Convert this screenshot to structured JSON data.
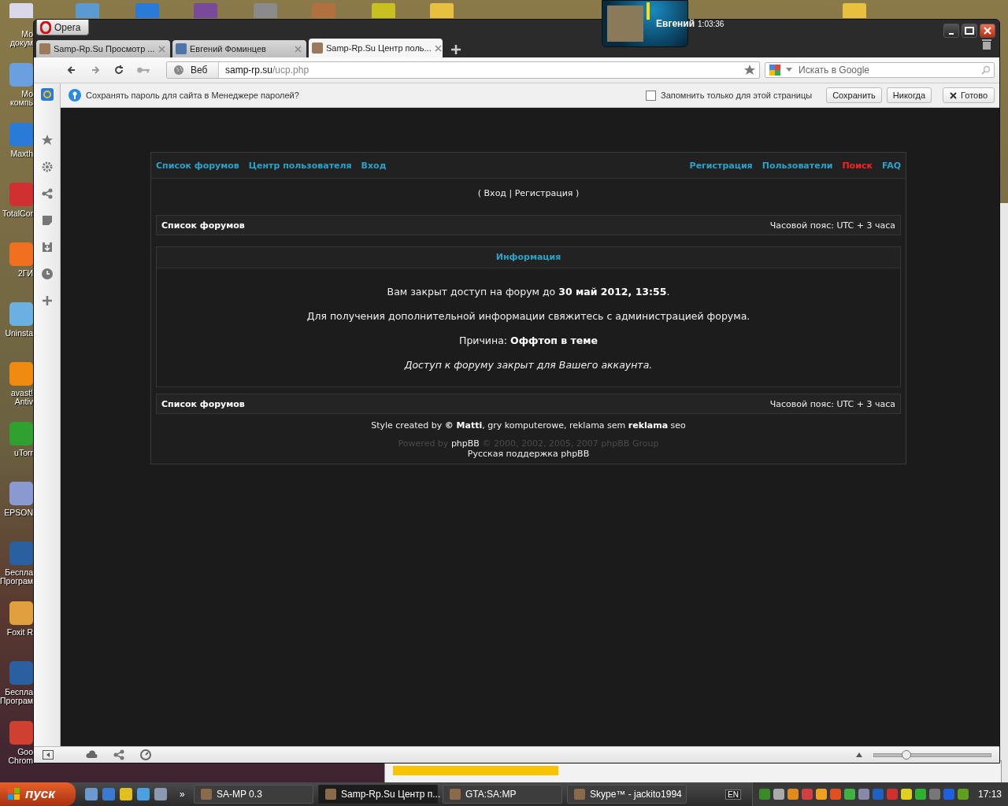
{
  "desktop": {
    "icons": [
      {
        "label": "Мо\nдокум"
      },
      {
        "label": "Мо\nкомпь"
      },
      {
        "label": "Maxth"
      },
      {
        "label": "TotalCor"
      },
      {
        "label": "2ГИ"
      },
      {
        "label": "Uninsta"
      },
      {
        "label": "avast!\nAntiv"
      },
      {
        "label": "uTorr"
      },
      {
        "label": "EPSON"
      },
      {
        "label": "Беспла\nПрограм"
      },
      {
        "label": "Foxit R"
      },
      {
        "label": "Беспла\nПрограм"
      },
      {
        "label": "Goo\nChrom"
      }
    ]
  },
  "skype_popup": {
    "name": "Евгений",
    "duration": "1:03:36"
  },
  "browser": {
    "menu_button": "Opera",
    "tabs": [
      {
        "title": "Samp-Rp.Su Просмотр ...",
        "selected": false
      },
      {
        "title": "Евгений Фоминцев",
        "selected": false
      },
      {
        "title": "Samp-Rp.Su Центр поль...",
        "selected": true
      }
    ],
    "address": {
      "mode": "Веб",
      "host": "samp-rp.su",
      "path": "/ucp.php"
    },
    "search": {
      "placeholder": "Искать в Google"
    },
    "password_bar": {
      "message": "Сохранять пароль для сайта в Менеджере паролей?",
      "remember_label": "Запомнить только для этой страницы",
      "remember_checked": false,
      "buttons": [
        "Сохранить",
        "Никогда"
      ],
      "close_label": "Готово"
    },
    "zoom": {
      "level": 0.28
    }
  },
  "forum": {
    "nav_left": [
      "Список форумов",
      "Центр пользователя",
      "Вход"
    ],
    "nav_right": [
      {
        "label": "Регистрация",
        "color": "#2aa3c9"
      },
      {
        "label": "Пользователи",
        "color": "#2aa3c9"
      },
      {
        "label": "Поиск",
        "color": "#ff2020"
      },
      {
        "label": "FAQ",
        "color": "#2aa3c9"
      }
    ],
    "login_line": "( Вход | Регистрация )",
    "breadcrumb_top": {
      "title": "Список форумов",
      "timezone": "Часовой пояс: UTC + 3 часа"
    },
    "info": {
      "title": "Информация",
      "messages": [
        {
          "kind": "text",
          "text": "Вам закрыт доступ на форум до **30 май 2012, 13:55**."
        },
        {
          "kind": "text",
          "text": "Для получения дополнительной информации свяжитесь с администрацией форума."
        },
        {
          "kind": "text",
          "text": "Причина: **Оффтоп в теме**"
        },
        {
          "kind": "note",
          "text": "Доступ к форуму закрыт для Вашего аккаунта."
        }
      ]
    },
    "breadcrumb_bottom": {
      "title": "Список форумов",
      "timezone": "Часовой пояс: UTC + 3 часа"
    },
    "credits": "Style created by **© Matti**, gry komputerowe, reklama sem **reklama** seo",
    "powered": {
      "prefix": "Powered by",
      "link": "phpBB",
      "suffix": "© 2000, 2002, 2005, 2007 phpBB Group"
    },
    "support": "Русская поддержка phpBB"
  },
  "taskbar": {
    "start": "пуск",
    "more": "»",
    "tasks": [
      {
        "title": "SA-MP 0.3",
        "selected": false
      },
      {
        "title": "Samp-Rp.Su Центр п...",
        "selected": true
      },
      {
        "title": "GTA:SA:MP",
        "selected": false
      },
      {
        "title": "Skype™ - jackito1994",
        "selected": false
      }
    ],
    "language": "EN",
    "clock": "17:13"
  }
}
